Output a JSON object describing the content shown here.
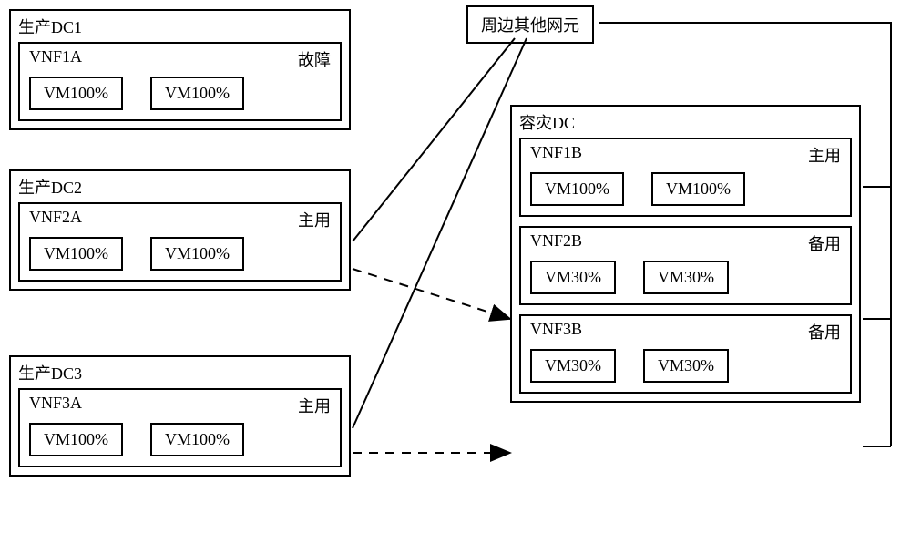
{
  "peripheral": {
    "label": "周边其他网元"
  },
  "left": {
    "dc1": {
      "title": "生产DC1",
      "vnf": {
        "name": "VNF1A",
        "status": "故障",
        "vm1": "VM100%",
        "vm2": "VM100%"
      }
    },
    "dc2": {
      "title": "生产DC2",
      "vnf": {
        "name": "VNF2A",
        "status": "主用",
        "vm1": "VM100%",
        "vm2": "VM100%"
      }
    },
    "dc3": {
      "title": "生产DC3",
      "vnf": {
        "name": "VNF3A",
        "status": "主用",
        "vm1": "VM100%",
        "vm2": "VM100%"
      }
    }
  },
  "right": {
    "title": "容灾DC",
    "vnf1": {
      "name": "VNF1B",
      "status": "主用",
      "vm1": "VM100%",
      "vm2": "VM100%"
    },
    "vnf2": {
      "name": "VNF2B",
      "status": "备用",
      "vm1": "VM30%",
      "vm2": "VM30%"
    },
    "vnf3": {
      "name": "VNF3B",
      "status": "备用",
      "vm1": "VM30%",
      "vm2": "VM30%"
    }
  },
  "chart_data": {
    "type": "diagram",
    "title": "VNF disaster-recovery topology",
    "nodes": [
      {
        "id": "peripheral",
        "label": "周边其他网元"
      },
      {
        "id": "dc1",
        "label": "生产DC1",
        "vnfs": [
          {
            "name": "VNF1A",
            "status": "故障",
            "vm_load": [
              "100%",
              "100%"
            ]
          }
        ]
      },
      {
        "id": "dc2",
        "label": "生产DC2",
        "vnfs": [
          {
            "name": "VNF2A",
            "status": "主用",
            "vm_load": [
              "100%",
              "100%"
            ]
          }
        ]
      },
      {
        "id": "dc3",
        "label": "生产DC3",
        "vnfs": [
          {
            "name": "VNF3A",
            "status": "主用",
            "vm_load": [
              "100%",
              "100%"
            ]
          }
        ]
      },
      {
        "id": "dr",
        "label": "容灾DC",
        "vnfs": [
          {
            "name": "VNF1B",
            "status": "主用",
            "vm_load": [
              "100%",
              "100%"
            ]
          },
          {
            "name": "VNF2B",
            "status": "备用",
            "vm_load": [
              "30%",
              "30%"
            ]
          },
          {
            "name": "VNF3B",
            "status": "备用",
            "vm_load": [
              "30%",
              "30%"
            ]
          }
        ]
      }
    ],
    "edges": [
      {
        "from": "peripheral",
        "to": "VNF2A",
        "style": "solid"
      },
      {
        "from": "peripheral",
        "to": "VNF3A",
        "style": "solid"
      },
      {
        "from": "peripheral",
        "to": "VNF1B",
        "style": "solid",
        "via": "right-bus"
      },
      {
        "from": "peripheral",
        "to": "VNF2B",
        "style": "solid",
        "via": "right-bus"
      },
      {
        "from": "peripheral",
        "to": "VNF3B",
        "style": "solid",
        "via": "right-bus"
      },
      {
        "from": "VNF2A",
        "to": "VNF2B",
        "style": "dashed",
        "arrow": true
      },
      {
        "from": "VNF3A",
        "to": "VNF3B",
        "style": "dashed",
        "arrow": true
      }
    ]
  }
}
